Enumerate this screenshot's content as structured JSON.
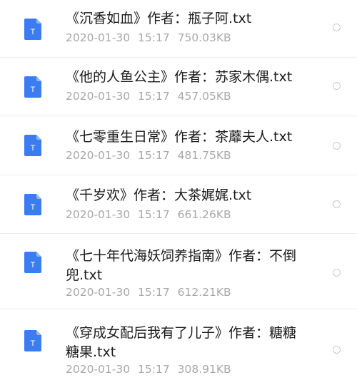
{
  "files": [
    {
      "name": "《沉香如血》作者：瓶子阿.txt",
      "date": "2020-01-30",
      "time": "15:17",
      "size": "750.03KB",
      "icon": "text-file-icon"
    },
    {
      "name": "《他的人鱼公主》作者：苏家木偶.txt",
      "date": "2020-01-30",
      "time": "15:17",
      "size": "457.05KB",
      "icon": "text-file-icon"
    },
    {
      "name": "《七零重生日常》作者：茶蘼夫人.txt",
      "date": "2020-01-30",
      "time": "15:17",
      "size": "481.75KB",
      "icon": "text-file-icon"
    },
    {
      "name": "《千岁欢》作者：大茶娓娓.txt",
      "date": "2020-01-30",
      "time": "15:17",
      "size": "661.26KB",
      "icon": "text-file-icon"
    },
    {
      "name": "《七十年代海妖饲养指南》作者：不倒兜.txt",
      "date": "2020-01-30",
      "time": "15:17",
      "size": "612.21KB",
      "icon": "text-file-icon"
    },
    {
      "name": "《穿成女配后我有了儿子》作者：糖糖糖果.txt",
      "date": "2020-01-30",
      "time": "15:17",
      "size": "308.91KB",
      "icon": "text-file-icon"
    }
  ],
  "icon_glyph": "T",
  "colors": {
    "icon_blue": "#3b7cf0",
    "icon_fold": "#8fb6f7",
    "title_text": "#1a1a1a",
    "meta_text": "#a8a8a8",
    "divider": "#ececec",
    "radio_border": "#c8c8c8"
  }
}
